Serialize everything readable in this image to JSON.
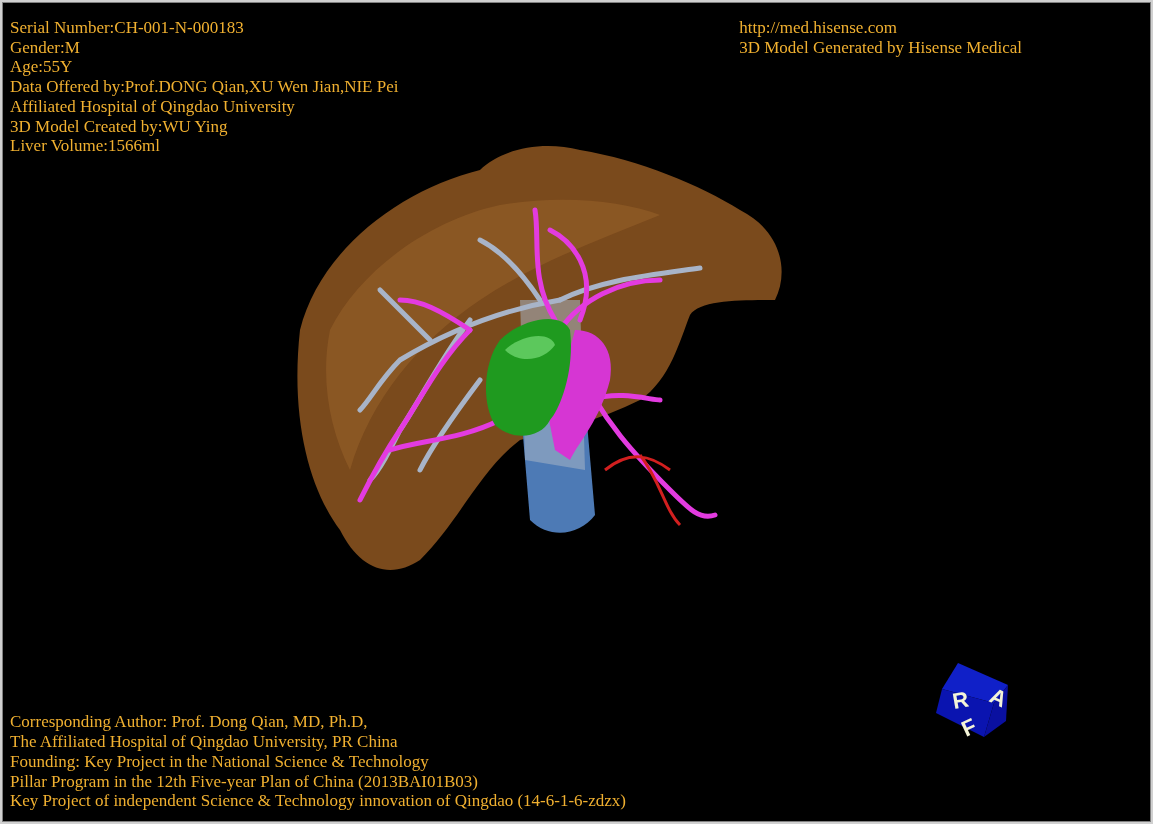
{
  "viewer": {
    "patient_info": [
      "Serial Number:CH-001-N-000183",
      "Gender:M",
      "Age:55Y",
      "Data Offered by:Prof.DONG Qian,XU Wen Jian,NIE Pei",
      "Affiliated Hospital of Qingdao University",
      "3D Model Created by:WU Ying",
      "Liver Volume:1566ml"
    ],
    "source_info": [
      "http://med.hisense.com",
      "3D Model Generated by Hisense Medical"
    ],
    "credits": [
      "Corresponding Author: Prof. Dong Qian, MD, Ph.D,",
      "The Affiliated Hospital of Qingdao University, PR China",
      "Founding: Key Project in the National Science & Technology",
      "Pillar Program in the 12th Five-year Plan of China (2013BAI01B03)",
      "Key Project of independent Science & Technology innovation of Qingdao (14-6-1-6-zdzx)"
    ],
    "orientation_cube": {
      "faces": [
        "R",
        "A",
        "F"
      ]
    }
  }
}
